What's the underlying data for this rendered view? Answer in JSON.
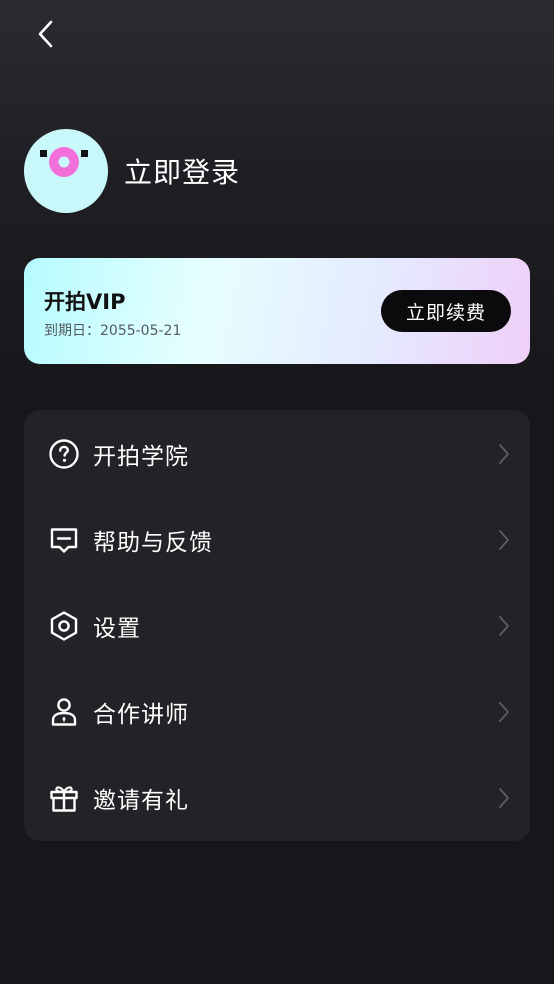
{
  "header": {
    "back_icon": "chevron-left-icon"
  },
  "profile": {
    "avatar_icon": "donut-avatar-icon",
    "login_label": "立即登录"
  },
  "vip": {
    "title": "开拍VIP",
    "expire_text": "到期日：2055-05-21",
    "renew_label": "立即续费"
  },
  "menu": {
    "items": [
      {
        "label": "开拍学院",
        "icon": "question-circle-icon"
      },
      {
        "label": "帮助与反馈",
        "icon": "feedback-message-icon"
      },
      {
        "label": "设置",
        "icon": "settings-hexagon-icon"
      },
      {
        "label": "合作讲师",
        "icon": "lecturer-person-icon"
      },
      {
        "label": "邀请有礼",
        "icon": "gift-icon"
      }
    ]
  },
  "colors": {
    "background": "#17171b",
    "menu_background": "#222227",
    "avatar_background": "#c9f8fb",
    "avatar_accent": "#f26fd9",
    "button_background": "#0b0b0d"
  }
}
